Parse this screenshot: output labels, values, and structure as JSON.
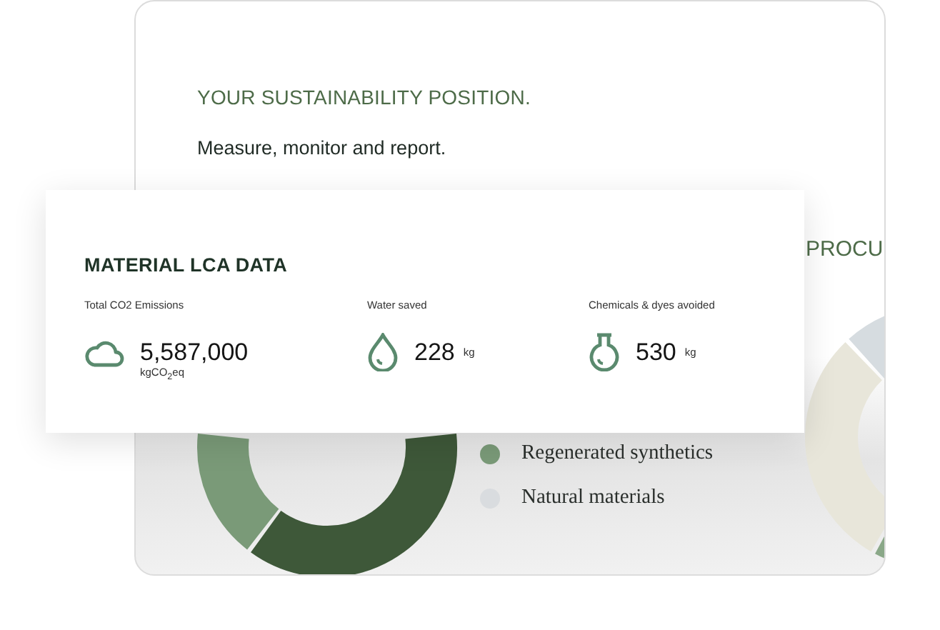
{
  "background_panel": {
    "title": "YOUR SUSTAINABILITY POSITION.",
    "subtitle": "Measure, monitor and report.",
    "side_heading": "PROCU",
    "legend": [
      {
        "label": "Regenerated synthetics",
        "color": "#7a9a78"
      },
      {
        "label": "Natural materials",
        "color": "#d9dcdf"
      }
    ]
  },
  "lca_card": {
    "title": "MATERIAL LCA DATA",
    "metrics": [
      {
        "label": "Total CO2 Emissions",
        "kind": "emissions",
        "value": "5,587,000",
        "unit": "kgCO$_{2}$eq"
      },
      {
        "label": "Water saved",
        "kind": "water",
        "value": "228",
        "unit": "kg"
      },
      {
        "label": "Chemicals & dyes avoided",
        "kind": "chemicals",
        "value": "530",
        "unit": "kg"
      }
    ]
  }
}
